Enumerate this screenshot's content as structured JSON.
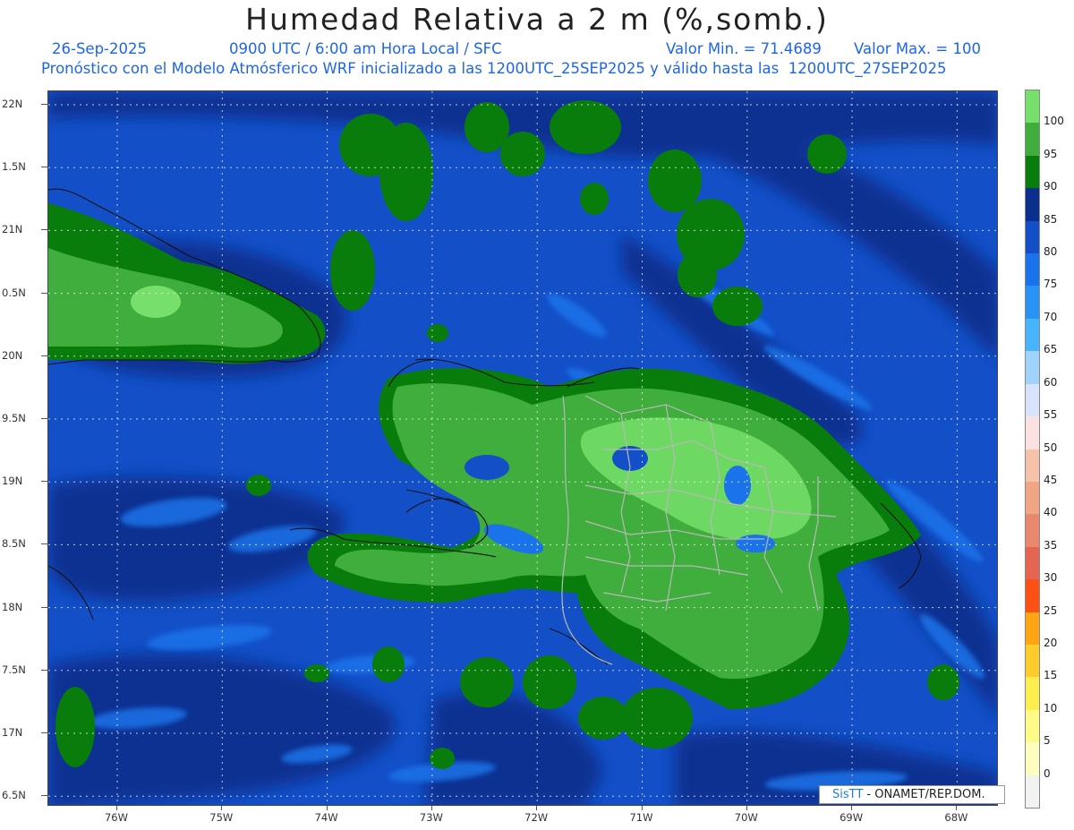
{
  "title": "Humedad Relativa a 2 m (%,somb.)",
  "header": {
    "date": "26-Sep-2025",
    "time_info": "0900 UTC / 6:00 am Hora Local / SFC",
    "min_label": "Valor Min. = 71.4689",
    "max_label": "Valor Max. = 100",
    "forecast_info": "Pronóstico con el Modelo Atmósferico WRF inicializado a las 1200UTC_25SEP2025 y válido hasta las  1200UTC_27SEP2025"
  },
  "axes": {
    "lat_labels": [
      "22N",
      "1.5N",
      "21N",
      "0.5N",
      "20N",
      "9.5N",
      "19N",
      "8.5N",
      "18N",
      "7.5N",
      "17N",
      "6.5N"
    ],
    "lon_labels": [
      "76W",
      "75W",
      "74W",
      "73W",
      "72W",
      "71W",
      "70W",
      "69W",
      "68W"
    ]
  },
  "colorbar": {
    "labels": [
      "100",
      "95",
      "90",
      "85",
      "80",
      "75",
      "70",
      "65",
      "60",
      "55",
      "50",
      "45",
      "40",
      "35",
      "30",
      "25",
      "20",
      "15",
      "10",
      "5",
      "0"
    ],
    "colors": [
      "#76e06a",
      "#3fae3c",
      "#087d0c",
      "#0a2f8c",
      "#1350c8",
      "#1a73ea",
      "#2893f4",
      "#48b4fb",
      "#9fd3fb",
      "#d9e4fb",
      "#fbe1e1",
      "#f7c2aa",
      "#f0a585",
      "#ea8770",
      "#e56552",
      "#fd5014",
      "#fda513",
      "#fdcc2b",
      "#fdee50",
      "#fdfa88",
      "#fdfdc0",
      "#f2f2f2"
    ]
  },
  "credit": {
    "brand": "SisTT",
    "text": " - ONAMET/REP.DOM."
  },
  "colors": {
    "ocean_deep": "#0a2f8c",
    "ocean": "#1350c8",
    "ocean_light": "#1a73ea",
    "land_green": "#087d0c",
    "land_mid": "#3fae3c",
    "land_light": "#76e06a",
    "border": "#b8b8b8"
  }
}
